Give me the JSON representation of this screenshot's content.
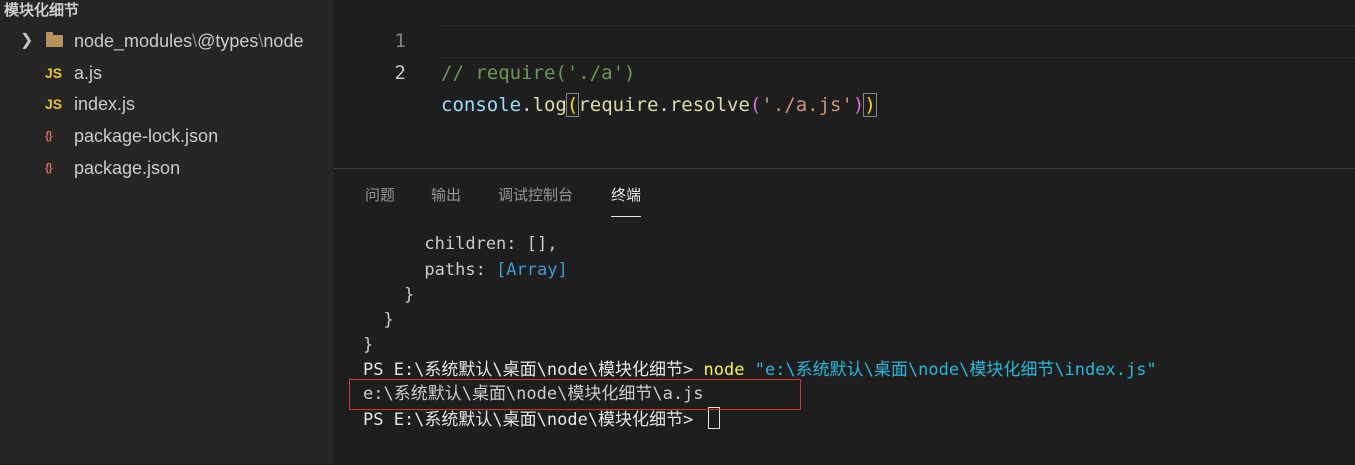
{
  "sidebar": {
    "folder_title": "模块化细节",
    "items": [
      {
        "type": "folder",
        "path_parts": [
          "node_modules",
          "@types",
          "node"
        ],
        "separator": "\\"
      },
      {
        "type": "js",
        "icon_label": "JS",
        "name": "a.js"
      },
      {
        "type": "js",
        "icon_label": "JS",
        "name": "index.js"
      },
      {
        "type": "json",
        "icon_label": "{}",
        "name": "package-lock.json"
      },
      {
        "type": "json",
        "icon_label": "{}",
        "name": "package.json"
      }
    ]
  },
  "editor": {
    "lines": [
      {
        "number": "1",
        "comment": "// require('./a')"
      },
      {
        "number": "2",
        "tokens": {
          "obj": "console",
          "dot1": ".",
          "method": "log",
          "open1": "(",
          "req": "require",
          "dot2": ".",
          "resolve": "resolve",
          "open2": "(",
          "str": "'./a.js'",
          "close2": ")",
          "close1": ")"
        }
      }
    ]
  },
  "panel": {
    "tabs": [
      {
        "label": "问题",
        "active": false
      },
      {
        "label": "输出",
        "active": false
      },
      {
        "label": "调试控制台",
        "active": false
      },
      {
        "label": "终端",
        "active": true
      }
    ],
    "terminal": {
      "children_line": "      children: [],",
      "paths_key": "      paths: ",
      "paths_value": "[Array]",
      "close1": "    }",
      "close2": "  }",
      "close3": "}",
      "prompt1": "PS E:\\系统默认\\桌面\\node\\模块化细节> ",
      "cmd": "node",
      "cmd_arg": "\"e:\\系统默认\\桌面\\node\\模块化细节\\index.js\"",
      "output": "e:\\系统默认\\桌面\\node\\模块化细节\\a.js",
      "prompt2": "PS E:\\系统默认\\桌面\\node\\模块化细节> "
    }
  },
  "colors": {
    "highlight_box": "#d6322e",
    "js_icon": "#e8c82c",
    "json_icon": "#d16969",
    "folder_icon": "#b8945a"
  }
}
